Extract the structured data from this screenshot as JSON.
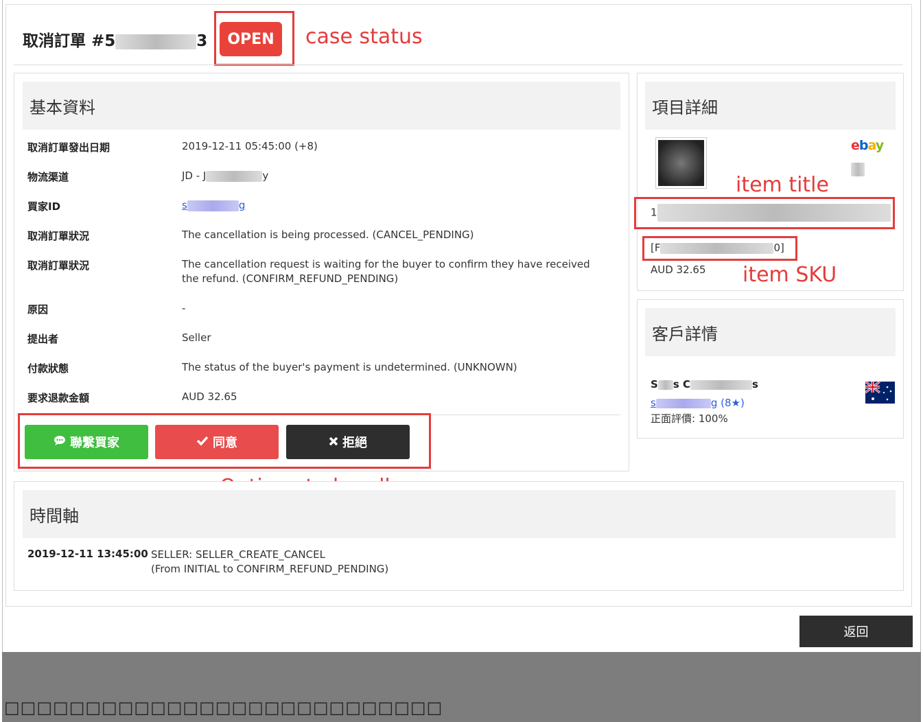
{
  "header": {
    "title_prefix": "取消訂單 #5",
    "title_suffix": "3",
    "status": "OPEN"
  },
  "annotations": {
    "case_status": "case status",
    "item_title": "item title",
    "item_sku": "item SKU",
    "options": "Options to handle case"
  },
  "basic_info": {
    "heading": "基本資料",
    "rows": [
      {
        "label": "取消訂單發出日期",
        "value": "2019-12-11 05:45:00 (+8)"
      },
      {
        "label": "物流渠道",
        "value_prefix": "JD - J",
        "value_suffix": "y"
      },
      {
        "label": "買家ID",
        "value_prefix": "s",
        "value_suffix": "g"
      },
      {
        "label": "取消訂單狀況",
        "value": "The cancellation is being processed. (CANCEL_PENDING)"
      },
      {
        "label": "取消訂單狀況",
        "value": "The cancellation request is waiting for the buyer to confirm they have received the refund. (CONFIRM_REFUND_PENDING)"
      },
      {
        "label": "原因",
        "value": "-"
      },
      {
        "label": "提出者",
        "value": "Seller"
      },
      {
        "label": "付款狀態",
        "value": "The status of the buyer's payment is undetermined. (UNKNOWN)"
      },
      {
        "label": "要求退款金額",
        "value": "AUD 32.65"
      }
    ]
  },
  "actions": {
    "contact": "聯繫買家",
    "agree": "同意",
    "reject": "拒絕"
  },
  "item_details": {
    "heading": "項目詳細",
    "ebay_letters": [
      "e",
      "b",
      "a",
      "y"
    ],
    "title_prefix": "1",
    "sku_prefix": "[F",
    "sku_suffix": "0]",
    "price": "AUD 32.65"
  },
  "customer": {
    "heading": "客戶詳情",
    "name_prefix": "S",
    "name_mid": "s C",
    "name_suffix": "s",
    "id_prefix": "s",
    "id_suffix": "g",
    "feedback": "(8",
    "star": "★",
    "feedback_close": ")",
    "positive": "正面評價: 100%"
  },
  "timeline": {
    "heading": "時間軸",
    "date": "2019-12-11 13:45:00",
    "line1": "SELLER: SELLER_CREATE_CANCEL",
    "line2": "(From INITIAL to CONFIRM_REFUND_PENDING)"
  },
  "back_button": "返回",
  "colors": {
    "accent_red": "#e8423a",
    "green": "#3fbe3f",
    "dark": "#2e2e2e",
    "annotation": "#e43c3c"
  }
}
